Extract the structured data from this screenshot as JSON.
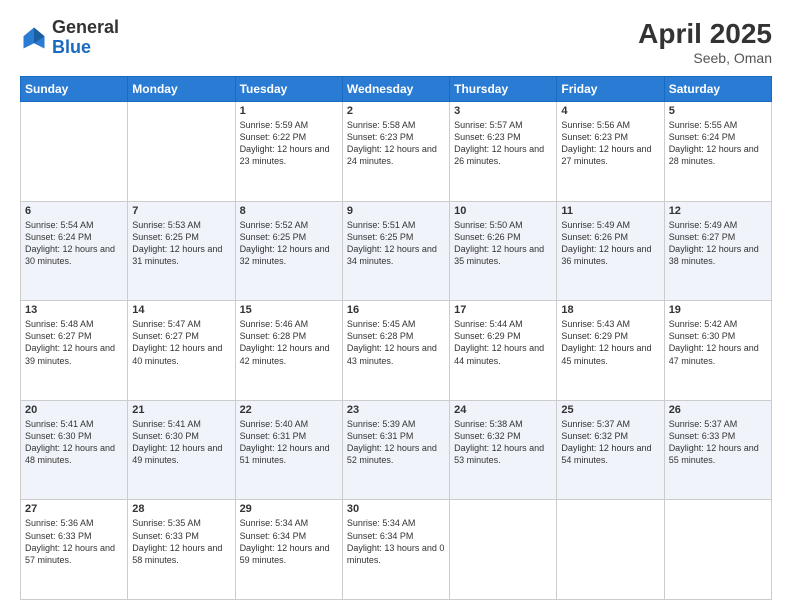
{
  "header": {
    "logo_general": "General",
    "logo_blue": "Blue",
    "month_year": "April 2025",
    "location": "Seeb, Oman"
  },
  "days_of_week": [
    "Sunday",
    "Monday",
    "Tuesday",
    "Wednesday",
    "Thursday",
    "Friday",
    "Saturday"
  ],
  "weeks": [
    [
      {
        "day": "",
        "sunrise": "",
        "sunset": "",
        "daylight": ""
      },
      {
        "day": "",
        "sunrise": "",
        "sunset": "",
        "daylight": ""
      },
      {
        "day": "1",
        "sunrise": "Sunrise: 5:59 AM",
        "sunset": "Sunset: 6:22 PM",
        "daylight": "Daylight: 12 hours and 23 minutes."
      },
      {
        "day": "2",
        "sunrise": "Sunrise: 5:58 AM",
        "sunset": "Sunset: 6:23 PM",
        "daylight": "Daylight: 12 hours and 24 minutes."
      },
      {
        "day": "3",
        "sunrise": "Sunrise: 5:57 AM",
        "sunset": "Sunset: 6:23 PM",
        "daylight": "Daylight: 12 hours and 26 minutes."
      },
      {
        "day": "4",
        "sunrise": "Sunrise: 5:56 AM",
        "sunset": "Sunset: 6:23 PM",
        "daylight": "Daylight: 12 hours and 27 minutes."
      },
      {
        "day": "5",
        "sunrise": "Sunrise: 5:55 AM",
        "sunset": "Sunset: 6:24 PM",
        "daylight": "Daylight: 12 hours and 28 minutes."
      }
    ],
    [
      {
        "day": "6",
        "sunrise": "Sunrise: 5:54 AM",
        "sunset": "Sunset: 6:24 PM",
        "daylight": "Daylight: 12 hours and 30 minutes."
      },
      {
        "day": "7",
        "sunrise": "Sunrise: 5:53 AM",
        "sunset": "Sunset: 6:25 PM",
        "daylight": "Daylight: 12 hours and 31 minutes."
      },
      {
        "day": "8",
        "sunrise": "Sunrise: 5:52 AM",
        "sunset": "Sunset: 6:25 PM",
        "daylight": "Daylight: 12 hours and 32 minutes."
      },
      {
        "day": "9",
        "sunrise": "Sunrise: 5:51 AM",
        "sunset": "Sunset: 6:25 PM",
        "daylight": "Daylight: 12 hours and 34 minutes."
      },
      {
        "day": "10",
        "sunrise": "Sunrise: 5:50 AM",
        "sunset": "Sunset: 6:26 PM",
        "daylight": "Daylight: 12 hours and 35 minutes."
      },
      {
        "day": "11",
        "sunrise": "Sunrise: 5:49 AM",
        "sunset": "Sunset: 6:26 PM",
        "daylight": "Daylight: 12 hours and 36 minutes."
      },
      {
        "day": "12",
        "sunrise": "Sunrise: 5:49 AM",
        "sunset": "Sunset: 6:27 PM",
        "daylight": "Daylight: 12 hours and 38 minutes."
      }
    ],
    [
      {
        "day": "13",
        "sunrise": "Sunrise: 5:48 AM",
        "sunset": "Sunset: 6:27 PM",
        "daylight": "Daylight: 12 hours and 39 minutes."
      },
      {
        "day": "14",
        "sunrise": "Sunrise: 5:47 AM",
        "sunset": "Sunset: 6:27 PM",
        "daylight": "Daylight: 12 hours and 40 minutes."
      },
      {
        "day": "15",
        "sunrise": "Sunrise: 5:46 AM",
        "sunset": "Sunset: 6:28 PM",
        "daylight": "Daylight: 12 hours and 42 minutes."
      },
      {
        "day": "16",
        "sunrise": "Sunrise: 5:45 AM",
        "sunset": "Sunset: 6:28 PM",
        "daylight": "Daylight: 12 hours and 43 minutes."
      },
      {
        "day": "17",
        "sunrise": "Sunrise: 5:44 AM",
        "sunset": "Sunset: 6:29 PM",
        "daylight": "Daylight: 12 hours and 44 minutes."
      },
      {
        "day": "18",
        "sunrise": "Sunrise: 5:43 AM",
        "sunset": "Sunset: 6:29 PM",
        "daylight": "Daylight: 12 hours and 45 minutes."
      },
      {
        "day": "19",
        "sunrise": "Sunrise: 5:42 AM",
        "sunset": "Sunset: 6:30 PM",
        "daylight": "Daylight: 12 hours and 47 minutes."
      }
    ],
    [
      {
        "day": "20",
        "sunrise": "Sunrise: 5:41 AM",
        "sunset": "Sunset: 6:30 PM",
        "daylight": "Daylight: 12 hours and 48 minutes."
      },
      {
        "day": "21",
        "sunrise": "Sunrise: 5:41 AM",
        "sunset": "Sunset: 6:30 PM",
        "daylight": "Daylight: 12 hours and 49 minutes."
      },
      {
        "day": "22",
        "sunrise": "Sunrise: 5:40 AM",
        "sunset": "Sunset: 6:31 PM",
        "daylight": "Daylight: 12 hours and 51 minutes."
      },
      {
        "day": "23",
        "sunrise": "Sunrise: 5:39 AM",
        "sunset": "Sunset: 6:31 PM",
        "daylight": "Daylight: 12 hours and 52 minutes."
      },
      {
        "day": "24",
        "sunrise": "Sunrise: 5:38 AM",
        "sunset": "Sunset: 6:32 PM",
        "daylight": "Daylight: 12 hours and 53 minutes."
      },
      {
        "day": "25",
        "sunrise": "Sunrise: 5:37 AM",
        "sunset": "Sunset: 6:32 PM",
        "daylight": "Daylight: 12 hours and 54 minutes."
      },
      {
        "day": "26",
        "sunrise": "Sunrise: 5:37 AM",
        "sunset": "Sunset: 6:33 PM",
        "daylight": "Daylight: 12 hours and 55 minutes."
      }
    ],
    [
      {
        "day": "27",
        "sunrise": "Sunrise: 5:36 AM",
        "sunset": "Sunset: 6:33 PM",
        "daylight": "Daylight: 12 hours and 57 minutes."
      },
      {
        "day": "28",
        "sunrise": "Sunrise: 5:35 AM",
        "sunset": "Sunset: 6:33 PM",
        "daylight": "Daylight: 12 hours and 58 minutes."
      },
      {
        "day": "29",
        "sunrise": "Sunrise: 5:34 AM",
        "sunset": "Sunset: 6:34 PM",
        "daylight": "Daylight: 12 hours and 59 minutes."
      },
      {
        "day": "30",
        "sunrise": "Sunrise: 5:34 AM",
        "sunset": "Sunset: 6:34 PM",
        "daylight": "Daylight: 13 hours and 0 minutes."
      },
      {
        "day": "",
        "sunrise": "",
        "sunset": "",
        "daylight": ""
      },
      {
        "day": "",
        "sunrise": "",
        "sunset": "",
        "daylight": ""
      },
      {
        "day": "",
        "sunrise": "",
        "sunset": "",
        "daylight": ""
      }
    ]
  ]
}
